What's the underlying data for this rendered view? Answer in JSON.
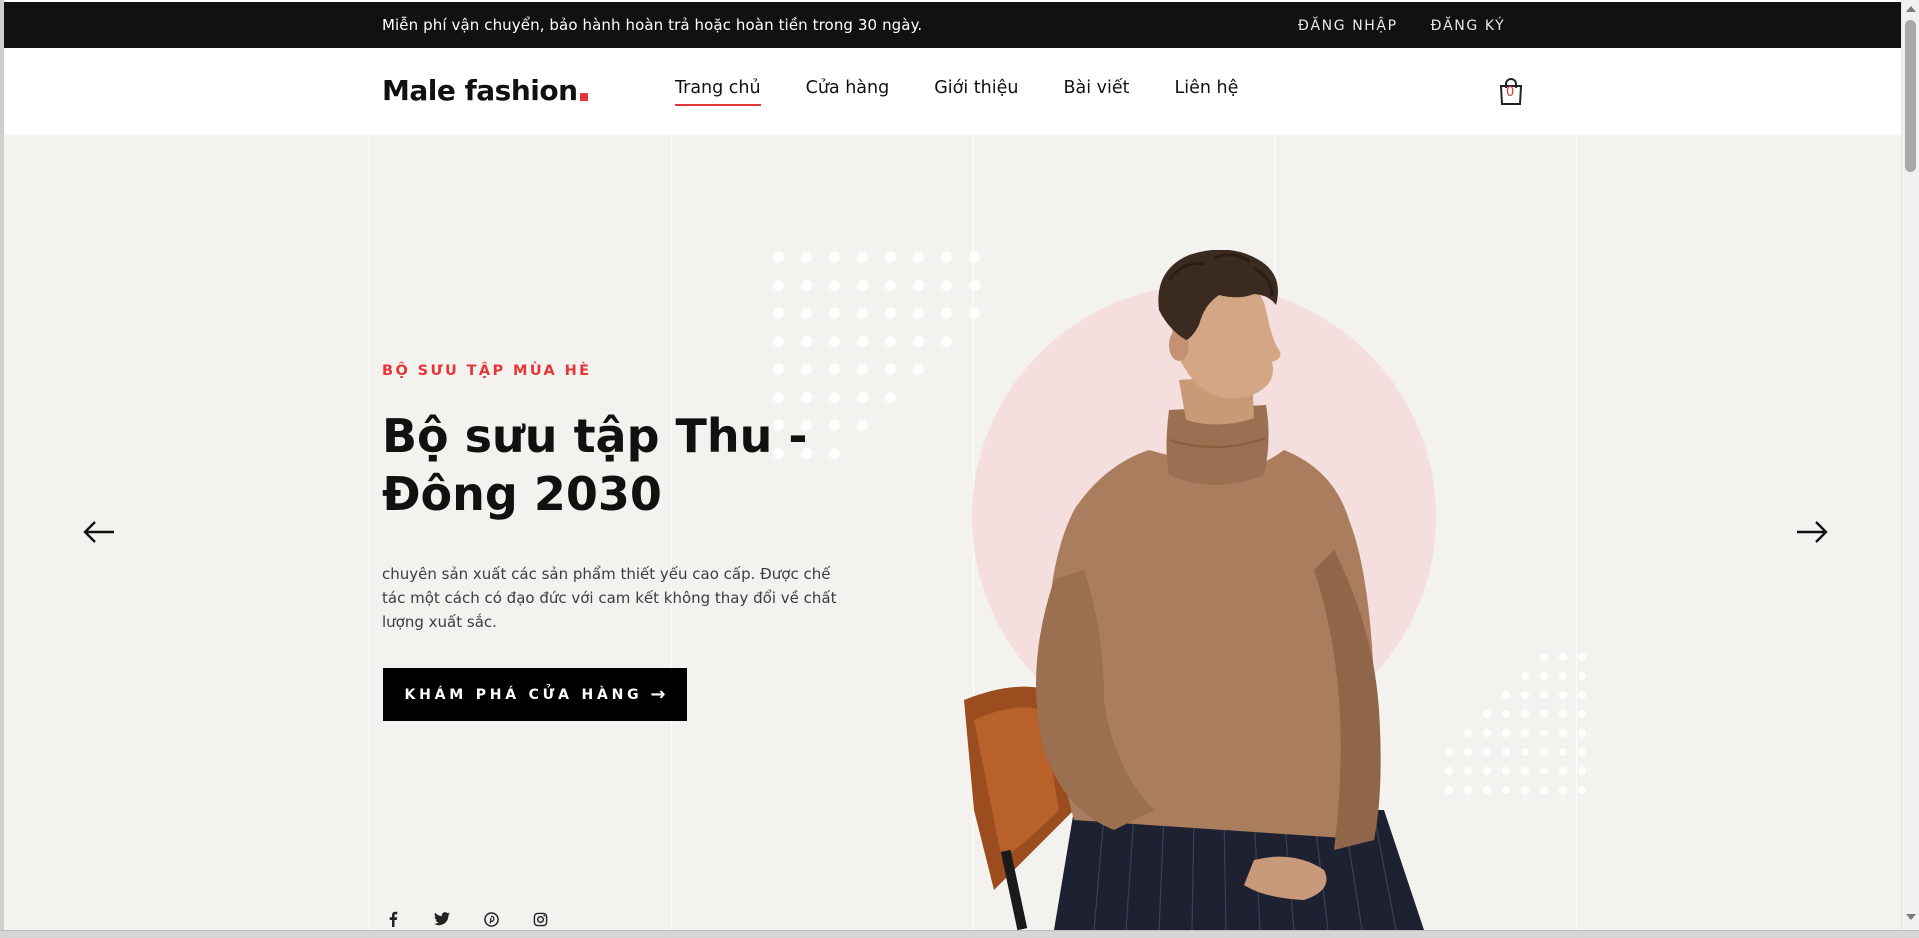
{
  "topbar": {
    "message": "Miễn phí vận chuyển, bảo hành hoàn trả hoặc hoàn tiền trong 30 ngày.",
    "login": "ĐĂNG NHẬP",
    "register": "ĐĂNG KÝ"
  },
  "header": {
    "logo_text": "Male fashion",
    "nav": [
      "Trang chủ",
      "Cửa hàng",
      "Giới thiệu",
      "Bài viết",
      "Liên hệ"
    ],
    "active_nav": "Trang chủ",
    "cart_count": "0"
  },
  "hero": {
    "subtitle": "BỘ SƯU TẬP MÙA HÈ",
    "title": "Bộ sưu tập Thu - Đông 2030",
    "description": "chuyên sản xuất các sản phẩm thiết yếu cao cấp. Được chế tác một cách có đạo đức với cam kết không thay đổi về chất lượng xuất sắc.",
    "button": "KHÁM PHÁ CỬA HÀNG",
    "social_icons": [
      "facebook-icon",
      "twitter-icon",
      "pinterest-icon",
      "instagram-icon"
    ]
  },
  "colors": {
    "accent": "#e53637",
    "topbar_bg": "#111111",
    "hero_bg": "#f3f2ee",
    "circle": "#f4dede",
    "sweater": "#a97d5d"
  }
}
